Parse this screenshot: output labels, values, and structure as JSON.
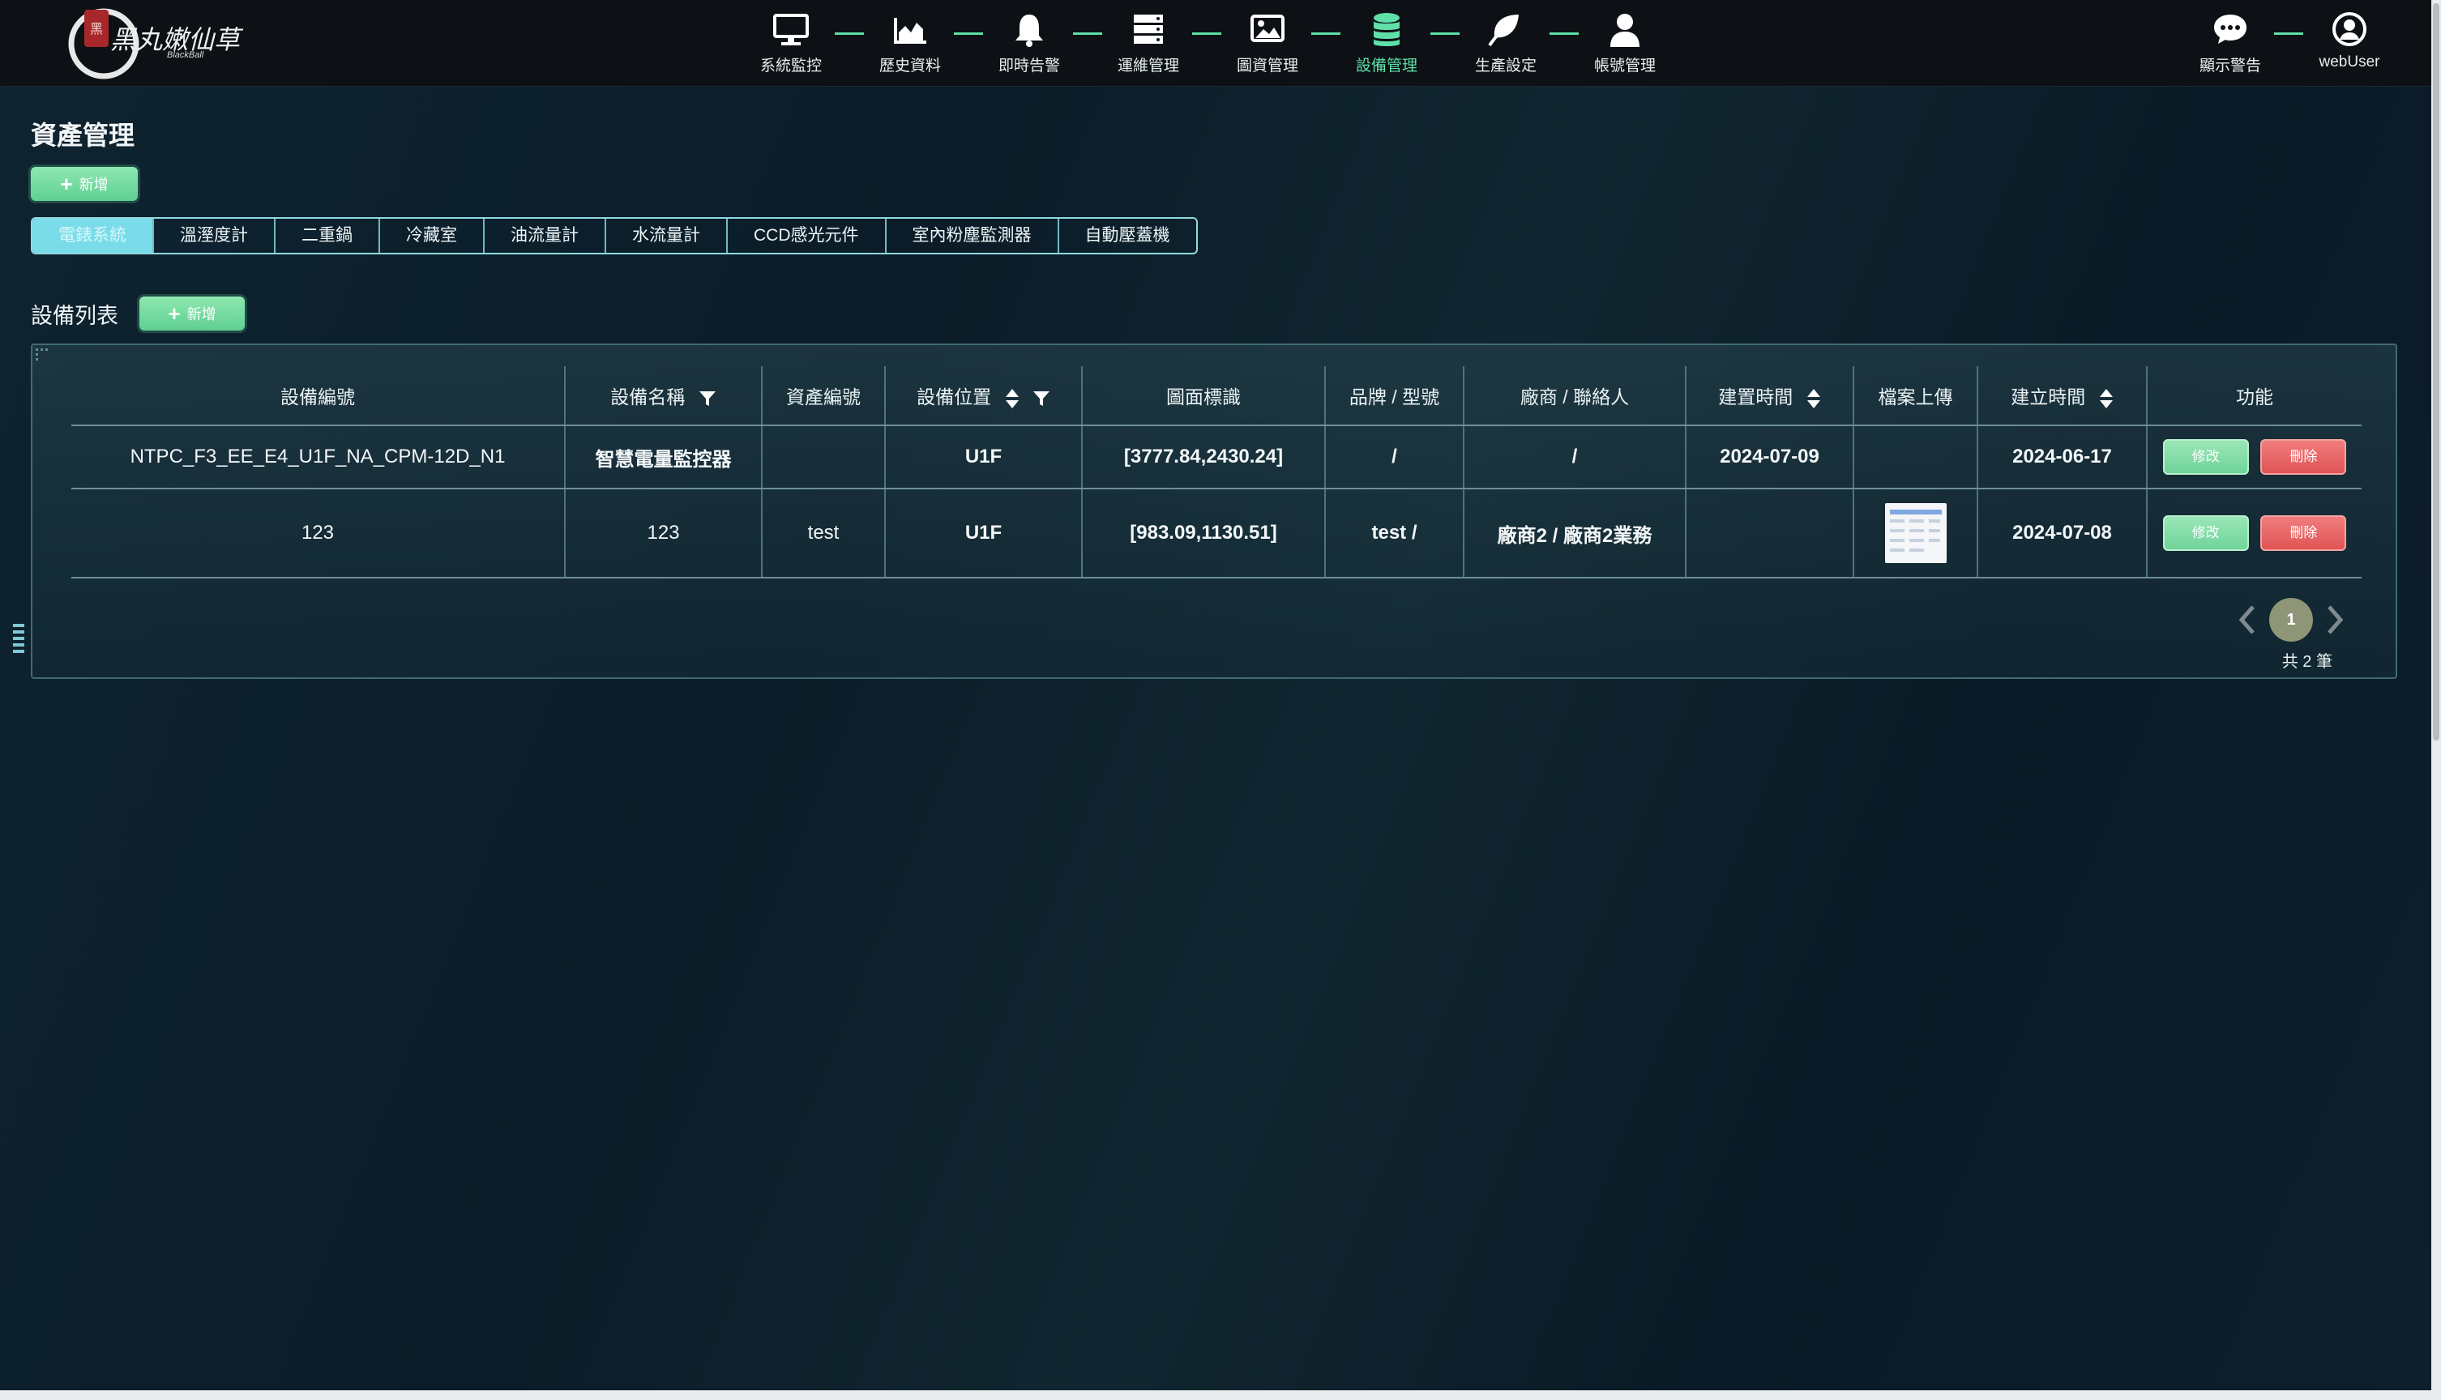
{
  "brand": {
    "logo_text": "黑丸嫩仙草",
    "logo_sub": "BlackBall"
  },
  "nav": {
    "items": [
      {
        "label": "系統監控",
        "icon": "monitor-icon"
      },
      {
        "label": "歷史資料",
        "icon": "area-chart-icon"
      },
      {
        "label": "即時告警",
        "icon": "bell-icon"
      },
      {
        "label": "運維管理",
        "icon": "server-icon"
      },
      {
        "label": "圖資管理",
        "icon": "image-icon"
      },
      {
        "label": "設備管理",
        "icon": "database-icon",
        "active": true
      },
      {
        "label": "生產設定",
        "icon": "leaf-icon"
      },
      {
        "label": "帳號管理",
        "icon": "user-icon"
      }
    ],
    "right": [
      {
        "label": "顯示警告",
        "icon": "chat-bubble-icon"
      },
      {
        "label": "webUser",
        "icon": "user-circle-icon"
      }
    ]
  },
  "page": {
    "title": "資產管理",
    "add_label": "新增",
    "tabs": [
      "電錶系統",
      "溫溼度計",
      "二重鍋",
      "冷藏室",
      "油流量計",
      "水流量計",
      "CCD感光元件",
      "室內粉塵監測器",
      "自動壓蓋機"
    ],
    "active_tab": "電錶系統",
    "section_title": "設備列表",
    "section_add_label": "新增"
  },
  "table": {
    "headers": [
      "設備編號",
      "設備名稱",
      "資產編號",
      "設備位置",
      "圖面標識",
      "品牌 / 型號",
      "廠商 / 聯絡人",
      "建置時間",
      "檔案上傳",
      "建立時間",
      "功能"
    ],
    "rows": [
      [
        "NTPC_F3_EE_E4_U1F_NA_CPM-12D_N1",
        "智慧電量監控器",
        "",
        "U1F",
        "[3777.84,2430.24]",
        "/",
        "/",
        "2024-07-09",
        "",
        "2024-06-17"
      ],
      [
        "123",
        "123",
        "test",
        "U1F",
        "[983.09,1130.51]",
        "test /",
        "廠商2 / 廠商2業務",
        "",
        "",
        "2024-07-08"
      ]
    ],
    "edit_label": "修改",
    "delete_label": "刪除"
  },
  "pagination": {
    "current": "1",
    "total_text": "共 2 筆"
  },
  "colors": {
    "accent": "#5ee0a8",
    "tab_active": "#79dce8",
    "delete": "#e05454",
    "edit": "#6fd49a"
  }
}
